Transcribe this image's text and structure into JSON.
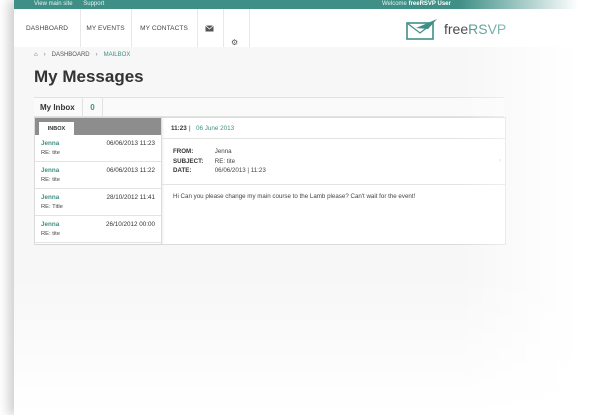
{
  "topbar": {
    "links": [
      "View main site",
      "Support"
    ],
    "welcome_prefix": "Welcome",
    "welcome_user": "freeRSVP User"
  },
  "nav": {
    "items": [
      "DASHBOARD",
      "MY EVENTS",
      "MY CONTACTS"
    ],
    "icons": [
      "envelope-icon",
      "gear-icon"
    ]
  },
  "logo": {
    "free": "free",
    "rsvp": "RSVP"
  },
  "breadcrumb": {
    "home_icon": "home-icon",
    "items": [
      "DASHBOARD",
      "MAILBOX"
    ]
  },
  "page_title": "My Messages",
  "inbox": {
    "label": "My Inbox",
    "count": "0"
  },
  "list": {
    "tab_label": "INBOX",
    "messages": [
      {
        "from": "Jenna",
        "date": "06/06/2013 11:23",
        "subject": "RE: tite"
      },
      {
        "from": "Jenna",
        "date": "06/06/2013 11:22",
        "subject": "RE: tite"
      },
      {
        "from": "Jenna",
        "date": "28/10/2012 11:41",
        "subject": "RE: Title"
      },
      {
        "from": "Jenna",
        "date": "26/10/2012 00:00",
        "subject": "RE: tite"
      }
    ]
  },
  "detail": {
    "time": "11:23",
    "separator": "|",
    "day": "06 June 2013",
    "from_label": "FROM:",
    "from_value": "Jenna",
    "subject_label": "SUBJECT:",
    "subject_value": "RE: tite",
    "date_label": "DATE:",
    "date_value": "06/06/2013 | 11:23",
    "body": "Hi Can you please change my main course to the Lamb please? Can't wait for the event!"
  },
  "colors": {
    "accent": "#3f8f86",
    "topbar": "#3f8f86",
    "list_header": "#8d8d8d"
  }
}
